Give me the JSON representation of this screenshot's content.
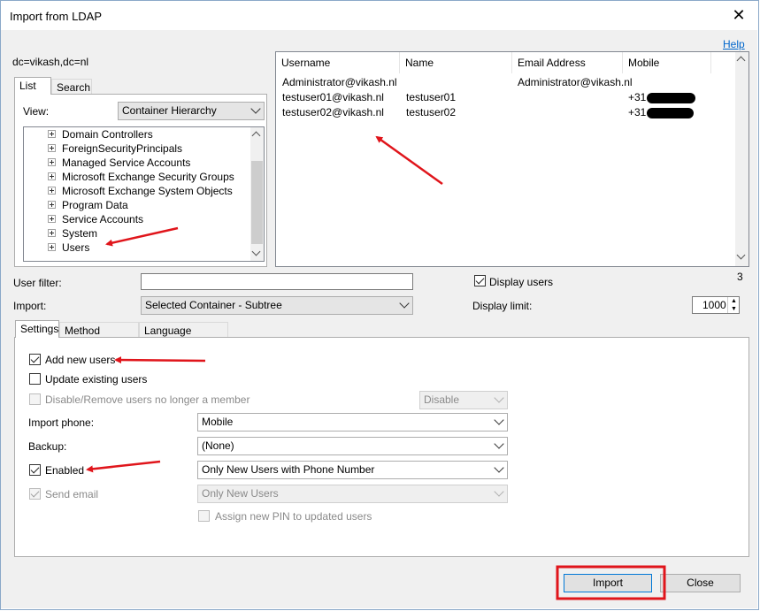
{
  "window": {
    "title": "Import from LDAP",
    "close_glyph": "✕"
  },
  "help_link": "Help",
  "base_dn": "dc=vikash,dc=nl",
  "left_tabs": [
    "List",
    "Search"
  ],
  "view": {
    "label": "View:",
    "value": "Container Hierarchy"
  },
  "tree_items": [
    "Domain Controllers",
    "ForeignSecurityPrincipals",
    "Managed Service Accounts",
    "Microsoft Exchange Security Groups",
    "Microsoft Exchange System Objects",
    "Program Data",
    "Service Accounts",
    "System",
    "Users"
  ],
  "users_table": {
    "columns": [
      "Username",
      "Name",
      "Email Address",
      "Mobile"
    ],
    "rows": [
      {
        "username": "Administrator@vikash.nl",
        "name": "",
        "email": "Administrator@vikash.nl",
        "mobile": ""
      },
      {
        "username": "testuser01@vikash.nl",
        "name": "testuser01",
        "email": "",
        "mobile": "+31"
      },
      {
        "username": "testuser02@vikash.nl",
        "name": "testuser02",
        "email": "",
        "mobile": "+31"
      }
    ],
    "count": "3"
  },
  "user_filter": {
    "label": "User filter:",
    "value": ""
  },
  "import_scope": {
    "label": "Import:",
    "value": "Selected Container - Subtree"
  },
  "display_users": {
    "label": "Display users",
    "checked": true
  },
  "display_limit": {
    "label": "Display limit:",
    "value": "1000"
  },
  "settings_tabs": [
    "Settings",
    "Method Defaults",
    "Language Defaults"
  ],
  "settings": {
    "add_new_users": {
      "label": "Add new users",
      "checked": true
    },
    "update_existing": {
      "label": "Update existing users",
      "checked": false
    },
    "disable_remove": {
      "label": "Disable/Remove users no longer a member",
      "checked": false,
      "option": "Disable"
    },
    "import_phone": {
      "label": "Import phone:",
      "value": "Mobile"
    },
    "backup": {
      "label": "Backup:",
      "value": "(None)"
    },
    "enabled": {
      "label": "Enabled",
      "checked": true,
      "value": "Only New Users with Phone Number"
    },
    "send_email": {
      "label": "Send email",
      "checked": true,
      "value": "Only New Users"
    },
    "assign_pin": {
      "label": "Assign new PIN to updated users",
      "checked": false
    }
  },
  "buttons": {
    "import": "Import",
    "close": "Close"
  },
  "colors": {
    "annotation_red": "#e0151b",
    "link_blue": "#0066cc",
    "focus_blue": "#0078d7"
  }
}
